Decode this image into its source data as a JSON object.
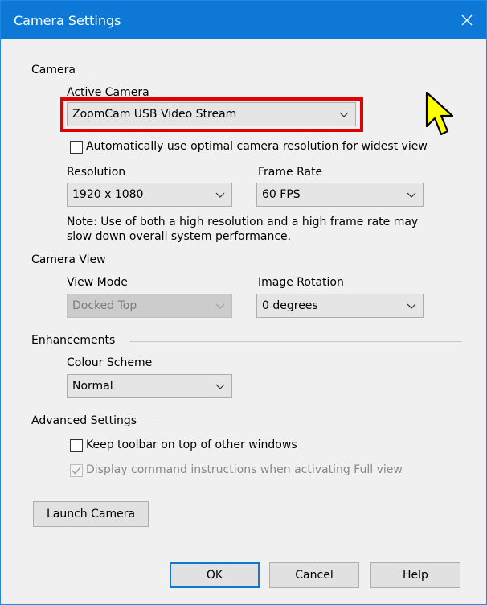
{
  "window": {
    "title": "Camera Settings"
  },
  "sections": {
    "camera": "Camera",
    "camera_view": "Camera View",
    "enhancements": "Enhancements",
    "advanced": "Advanced Settings"
  },
  "camera": {
    "active_camera_label": "Active Camera",
    "active_camera_value": "ZoomCam USB Video Stream",
    "auto_resolution_label": "Automatically use optimal camera resolution for widest view",
    "auto_resolution_checked": false,
    "resolution_label": "Resolution",
    "resolution_value": "1920 x 1080",
    "frame_rate_label": "Frame Rate",
    "frame_rate_value": "60 FPS",
    "note": "Note: Use of both a high resolution and a high frame rate may slow down overall system performance."
  },
  "camera_view": {
    "view_mode_label": "View Mode",
    "view_mode_value": "Docked Top",
    "image_rotation_label": "Image Rotation",
    "image_rotation_value": "0 degrees"
  },
  "enhancements": {
    "colour_scheme_label": "Colour Scheme",
    "colour_scheme_value": "Normal"
  },
  "advanced": {
    "keep_toolbar_label": "Keep toolbar on top of other windows",
    "keep_toolbar_checked": false,
    "display_instructions_label": "Display command instructions when activating Full view",
    "display_instructions_checked": true
  },
  "buttons": {
    "launch_camera": "Launch Camera",
    "ok": "OK",
    "cancel": "Cancel",
    "help": "Help"
  },
  "colors": {
    "titlebar": "#0e78d6",
    "highlight": "#e00000",
    "cursor": "#ffff00"
  }
}
